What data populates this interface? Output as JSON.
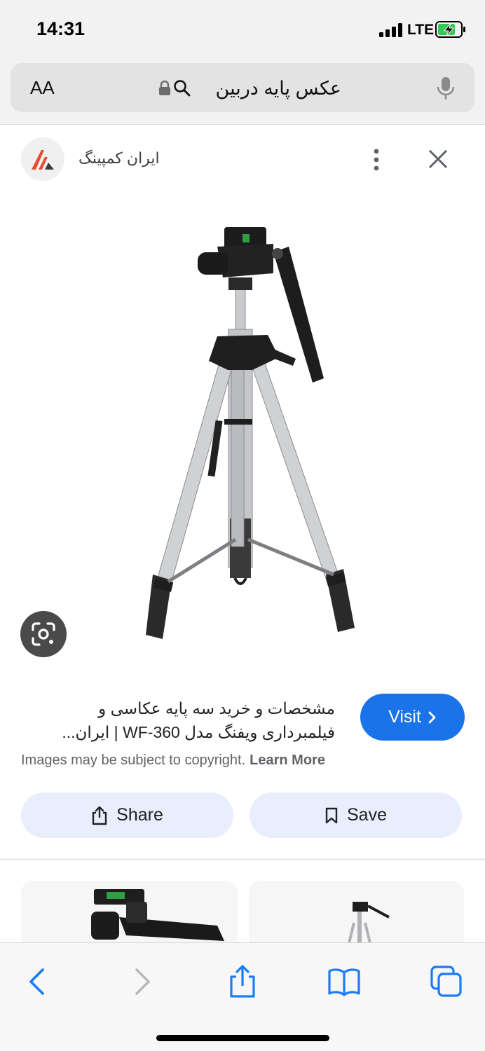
{
  "status_bar": {
    "time": "14:31",
    "network": "LTE"
  },
  "address_bar": {
    "text_size_label": "AA",
    "query": "عکس پایه دربین"
  },
  "source": {
    "name": "ایران کمپینگ"
  },
  "result": {
    "title_line1": "مشخصات و خرید سه پایه عکاسی و",
    "title_line2": "فیلمبرداری ویفنگ مدل WF-360 | ایران...",
    "visit_label": "Visit",
    "copyright_text": "Images may be subject to copyright.",
    "learn_more": "Learn More",
    "share_label": "Share",
    "save_label": "Save"
  },
  "colors": {
    "accent": "#1a73e8",
    "pill": "#e8eefb",
    "ios_blue": "#1a7cf5"
  },
  "icons": [
    "lock-icon",
    "search-icon",
    "mic-icon",
    "more-vert-icon",
    "close-icon",
    "lens-icon",
    "chevron-right-icon",
    "share-icon",
    "bookmark-icon",
    "back-icon",
    "forward-icon",
    "safari-share-icon",
    "bookmarks-icon",
    "tabs-icon"
  ]
}
